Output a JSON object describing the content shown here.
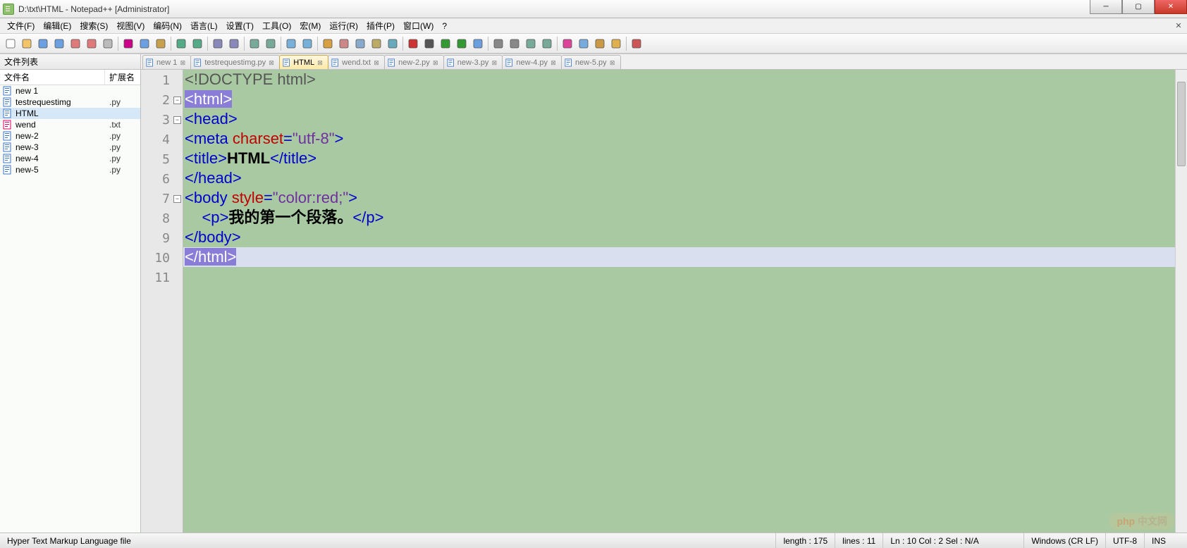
{
  "window": {
    "title": "D:\\txt\\HTML - Notepad++ [Administrator]"
  },
  "menu": {
    "items": [
      "文件(F)",
      "编辑(E)",
      "搜索(S)",
      "视图(V)",
      "编码(N)",
      "语言(L)",
      "设置(T)",
      "工具(O)",
      "宏(M)",
      "运行(R)",
      "插件(P)",
      "窗口(W)",
      "?"
    ]
  },
  "toolbar_groups": [
    [
      "new-file-icon",
      "open-file-icon",
      "save-icon",
      "save-all-icon",
      "close-icon",
      "close-all-icon",
      "print-icon"
    ],
    [
      "cut-icon",
      "copy-icon",
      "paste-icon"
    ],
    [
      "undo-icon",
      "redo-icon"
    ],
    [
      "find-icon",
      "replace-icon"
    ],
    [
      "zoom-in-icon",
      "zoom-out-icon"
    ],
    [
      "sync-v-icon",
      "sync-h-icon"
    ],
    [
      "wrap-icon",
      "show-all-icon",
      "indent-guide-icon",
      "lang-icon",
      "monitor-icon"
    ],
    [
      "record-icon",
      "stop-icon",
      "play-icon",
      "play-multi-icon",
      "save-macro-icon"
    ],
    [
      "outdent-icon",
      "indent-icon",
      "comment-icon",
      "uncomment-icon"
    ],
    [
      "doc-list-icon",
      "doc-map-icon",
      "func-list-icon",
      "folder-icon"
    ],
    [
      "spellcheck-icon"
    ]
  ],
  "sidebar": {
    "title": "文件列表",
    "col_name": "文件名",
    "col_ext": "扩展名",
    "files": [
      {
        "name": "new 1",
        "ext": "",
        "type": "new"
      },
      {
        "name": "testrequestimg",
        "ext": ".py",
        "type": "py"
      },
      {
        "name": "HTML",
        "ext": "",
        "type": "html",
        "active": true
      },
      {
        "name": "wend",
        "ext": ".txt",
        "type": "txt"
      },
      {
        "name": "new-2",
        "ext": ".py",
        "type": "py"
      },
      {
        "name": "new-3",
        "ext": ".py",
        "type": "py"
      },
      {
        "name": "new-4",
        "ext": ".py",
        "type": "py"
      },
      {
        "name": "new-5",
        "ext": ".py",
        "type": "py"
      }
    ]
  },
  "tabs": [
    {
      "label": "new 1",
      "close": true
    },
    {
      "label": "testrequestimg.py",
      "close": true
    },
    {
      "label": "HTML",
      "close": true,
      "active": true
    },
    {
      "label": "wend.txt",
      "close": true
    },
    {
      "label": "new-2.py",
      "close": true
    },
    {
      "label": "new-3.py",
      "close": true
    },
    {
      "label": "new-4.py",
      "close": true
    },
    {
      "label": "new-5.py",
      "close": true
    }
  ],
  "code": {
    "lines": [
      {
        "n": 1,
        "segs": [
          {
            "t": "<!DOCTYPE html>",
            "c": "c-gray"
          }
        ]
      },
      {
        "n": 2,
        "fold": true,
        "segs": [
          {
            "t": "<",
            "c": "c-blue",
            "hl": true
          },
          {
            "t": "html",
            "c": "c-blue",
            "hl": true
          },
          {
            "t": ">",
            "c": "c-blue",
            "hl": true
          }
        ],
        "hlparts": [
          0,
          1,
          2
        ]
      },
      {
        "n": 3,
        "fold": true,
        "segs": [
          {
            "t": "<",
            "c": "c-blue"
          },
          {
            "t": "head",
            "c": "c-blue"
          },
          {
            "t": ">",
            "c": "c-blue"
          }
        ]
      },
      {
        "n": 4,
        "segs": [
          {
            "t": "<",
            "c": "c-blue"
          },
          {
            "t": "meta ",
            "c": "c-blue"
          },
          {
            "t": "charset",
            "c": "c-red"
          },
          {
            "t": "=",
            "c": "c-blue"
          },
          {
            "t": "\"utf-8\"",
            "c": "c-purp"
          },
          {
            "t": ">",
            "c": "c-blue"
          }
        ]
      },
      {
        "n": 5,
        "segs": [
          {
            "t": "<",
            "c": "c-blue"
          },
          {
            "t": "title",
            "c": "c-blue"
          },
          {
            "t": ">",
            "c": "c-blue"
          },
          {
            "t": "HTML",
            "c": "c-black"
          },
          {
            "t": "</",
            "c": "c-blue"
          },
          {
            "t": "title",
            "c": "c-blue"
          },
          {
            "t": ">",
            "c": "c-blue"
          }
        ]
      },
      {
        "n": 6,
        "segs": [
          {
            "t": "</",
            "c": "c-blue"
          },
          {
            "t": "head",
            "c": "c-blue"
          },
          {
            "t": ">",
            "c": "c-blue"
          }
        ]
      },
      {
        "n": 7,
        "fold": true,
        "segs": [
          {
            "t": "<",
            "c": "c-blue"
          },
          {
            "t": "body ",
            "c": "c-blue"
          },
          {
            "t": "style",
            "c": "c-red"
          },
          {
            "t": "=",
            "c": "c-blue"
          },
          {
            "t": "\"color:red;\"",
            "c": "c-purp"
          },
          {
            "t": ">",
            "c": "c-blue"
          }
        ]
      },
      {
        "n": 8,
        "segs": [
          {
            "t": "    <",
            "c": "c-blue"
          },
          {
            "t": "p",
            "c": "c-blue"
          },
          {
            "t": ">",
            "c": "c-blue"
          },
          {
            "t": "我的第一个段落。",
            "c": "c-black"
          },
          {
            "t": "</",
            "c": "c-blue"
          },
          {
            "t": "p",
            "c": "c-blue"
          },
          {
            "t": ">",
            "c": "c-blue"
          }
        ]
      },
      {
        "n": 9,
        "segs": [
          {
            "t": "</",
            "c": "c-blue"
          },
          {
            "t": "body",
            "c": "c-blue"
          },
          {
            "t": ">",
            "c": "c-blue"
          }
        ]
      },
      {
        "n": 10,
        "current": true,
        "segs": [
          {
            "t": "</",
            "c": "c-blue",
            "hl": true
          },
          {
            "t": "html",
            "c": "c-blue",
            "hl": true
          },
          {
            "t": ">",
            "c": "c-blue",
            "hl": true
          }
        ]
      },
      {
        "n": 11,
        "segs": []
      }
    ]
  },
  "status": {
    "filetype": "Hyper Text Markup Language file",
    "length": "length : 175",
    "lines": "lines : 11",
    "pos": "Ln : 10    Col : 2    Sel : N/A",
    "eol": "Windows (CR LF)",
    "enc": "UTF-8",
    "ins": "INS"
  },
  "watermark": "php 中文网"
}
